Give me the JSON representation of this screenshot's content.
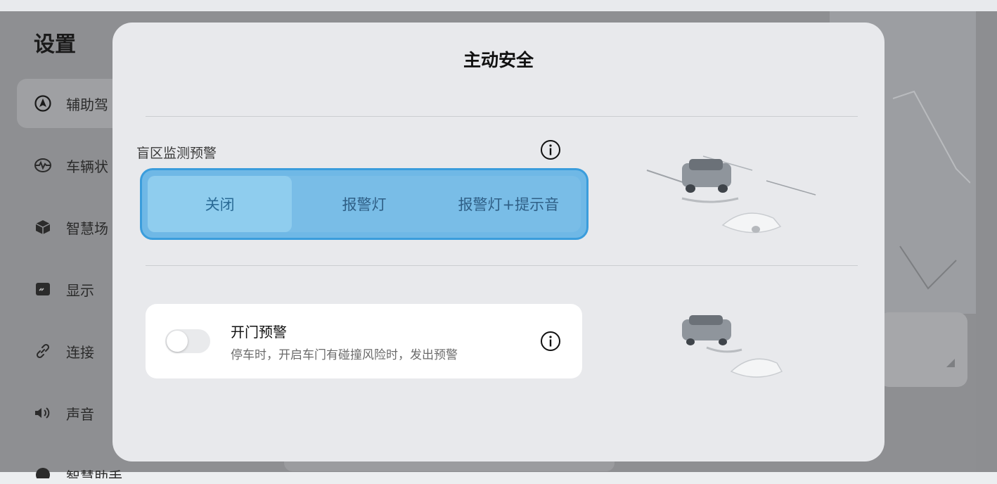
{
  "background": {
    "settings_title": "设置",
    "sidebar": [
      {
        "label": "辅助驾",
        "icon": "navigation-arrow-icon",
        "active": true
      },
      {
        "label": "车辆状",
        "icon": "vehicle-status-icon",
        "active": false
      },
      {
        "label": "智慧场",
        "icon": "cube-icon",
        "active": false
      },
      {
        "label": "显示",
        "icon": "display-icon",
        "active": false
      },
      {
        "label": "连接",
        "icon": "link-icon",
        "active": false
      },
      {
        "label": "声音",
        "icon": "speaker-icon",
        "active": false
      },
      {
        "label": "智慧助手",
        "icon": "assistant-icon",
        "active": false
      }
    ]
  },
  "modal": {
    "title": "主动安全",
    "blind_spot": {
      "label": "盲区监测预警",
      "options": [
        "关闭",
        "报警灯",
        "报警灯+提示音"
      ],
      "selected_index": 0
    },
    "door_warning": {
      "title": "开门预警",
      "description": "停车时，开启车门有碰撞风险时，发出预警",
      "enabled": false
    }
  },
  "colors": {
    "accent_border": "#3b9ddc",
    "segment_bg": "#6fb8e6",
    "segment_selected": "#8fcdee"
  }
}
